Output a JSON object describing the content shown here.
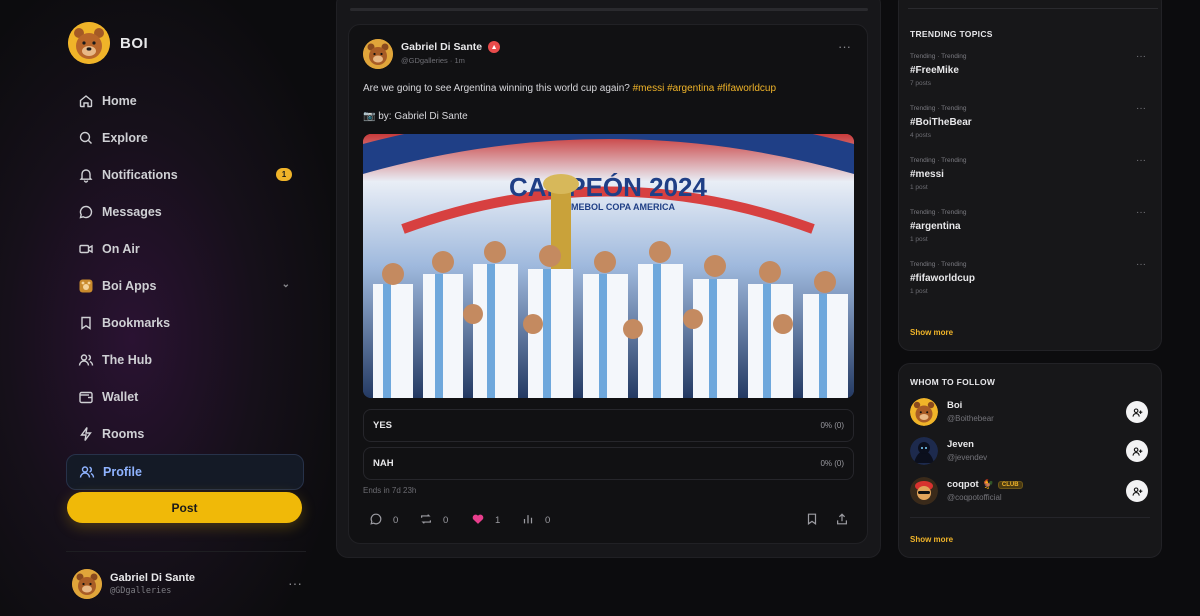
{
  "brand": {
    "name": "BOI"
  },
  "nav": [
    {
      "label": "Home",
      "icon": "home-icon"
    },
    {
      "label": "Explore",
      "icon": "search-icon"
    },
    {
      "label": "Notifications",
      "icon": "bell-icon",
      "badge": "1"
    },
    {
      "label": "Messages",
      "icon": "message-icon"
    },
    {
      "label": "On Air",
      "icon": "video-icon"
    },
    {
      "label": "Boi Apps",
      "icon": "apps-icon"
    },
    {
      "label": "Bookmarks",
      "icon": "bookmark-icon"
    },
    {
      "label": "The Hub",
      "icon": "users-icon"
    },
    {
      "label": "Wallet",
      "icon": "wallet-icon"
    },
    {
      "label": "Rooms",
      "icon": "bolt-icon"
    },
    {
      "label": "Profile",
      "icon": "profile-icon",
      "active": true
    }
  ],
  "sidebar": {
    "post_label": "Post",
    "user_name": "Gabriel Di Sante",
    "user_handle": "@GDgalleries",
    "more": "···"
  },
  "post": {
    "author": "Gabriel Di Sante",
    "handle": "@GDgalleries",
    "time": "1m",
    "text_plain": "Are we going to see Argentina winning this world cup again?",
    "hashtags": "#messi #argentina #fifaworldcup",
    "credit": "📷 by: Gabriel Di Sante",
    "image_alt": "Argentina team celebrating with Copa America trophy",
    "image_banner": "CAMPEÓN 2024",
    "image_subbanner": "CONMEBOL COPA AMERICA",
    "more": "···",
    "poll": [
      {
        "label": "YES",
        "result": "0% (0)"
      },
      {
        "label": "NAH",
        "result": "0% (0)"
      }
    ],
    "poll_ends": "Ends in 7d 23h",
    "actions": {
      "replies": "0",
      "reposts": "0",
      "likes": "1",
      "views": "0"
    }
  },
  "trending": {
    "title": "TRENDING TOPICS",
    "items": [
      {
        "kicker": "Trending · Trending",
        "tag": "#FreeMike",
        "count": "7 posts"
      },
      {
        "kicker": "Trending · Trending",
        "tag": "#BoiTheBear",
        "count": "4 posts"
      },
      {
        "kicker": "Trending · Trending",
        "tag": "#messi",
        "count": "1 post"
      },
      {
        "kicker": "Trending · Trending",
        "tag": "#argentina",
        "count": "1 post"
      },
      {
        "kicker": "Trending · Trending",
        "tag": "#fifaworldcup",
        "count": "1 post"
      }
    ],
    "more_icon": "···",
    "show_more": "Show more"
  },
  "follow": {
    "title": "WHOM TO FOLLOW",
    "items": [
      {
        "name": "Boi",
        "handle": "@Boithebear"
      },
      {
        "name": "Jeven",
        "handle": "@jevendev"
      },
      {
        "name": "coqpot",
        "handle": "@coqpotofficial",
        "badge": "CLUB"
      }
    ],
    "show_more": "Show more"
  },
  "colors": {
    "accent": "#f0b429",
    "active_nav": "#8fb3ff",
    "like": "#e83e8c"
  }
}
